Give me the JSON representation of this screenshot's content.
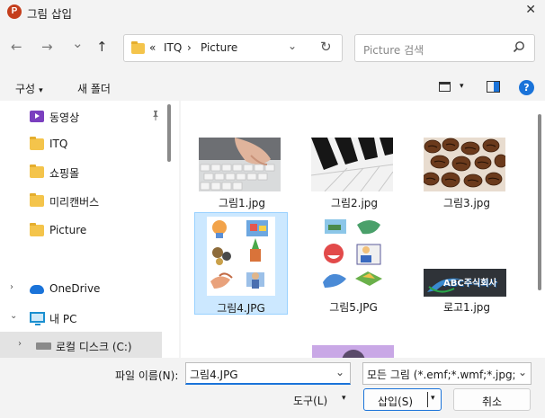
{
  "window": {
    "title": "그림 삽입",
    "app_icon": "P",
    "close": "✕"
  },
  "nav": {
    "back": "←",
    "forward": "→",
    "recent": "⌄",
    "up": "↑"
  },
  "address": {
    "prefix": "«",
    "segments": [
      "ITQ",
      "›",
      "Picture"
    ],
    "chevron": "⌄",
    "refresh": "↻"
  },
  "search": {
    "placeholder": "Picture 검색"
  },
  "toolbar": {
    "organize": "구성",
    "organize_caret": "▾",
    "new_folder": "새 폴더",
    "view_caret": "▾",
    "help": "?"
  },
  "sidebar": {
    "items": [
      {
        "label": "동영상",
        "icon": "video-icon",
        "pinned": true
      },
      {
        "label": "ITQ",
        "icon": "folder-icon"
      },
      {
        "label": "쇼핑몰",
        "icon": "folder-icon"
      },
      {
        "label": "미리캔버스",
        "icon": "folder-icon"
      },
      {
        "label": "Picture",
        "icon": "folder-icon"
      },
      {
        "label": "OneDrive",
        "icon": "cloud-icon",
        "expander": "›"
      },
      {
        "label": "내 PC",
        "icon": "pc-icon",
        "expander": "⌄"
      },
      {
        "label": "로컬 디스크 (C:)",
        "icon": "drive-icon",
        "expander": "›",
        "selected": true
      }
    ],
    "pin": "📌"
  },
  "files": [
    {
      "name": "그림1.jpg",
      "thumb": "keyboard"
    },
    {
      "name": "그림2.jpg",
      "thumb": "piano"
    },
    {
      "name": "그림3.jpg",
      "thumb": "coffee"
    },
    {
      "name": "그림4.JPG",
      "thumb": "clipart-a",
      "selected": true
    },
    {
      "name": "그림5.JPG",
      "thumb": "clipart-b"
    },
    {
      "name": "로고1.jpg",
      "thumb": "logo",
      "logo_text": "ABC주식회사"
    }
  ],
  "colors": {
    "accent": "#1a73d9",
    "selected_bg": "#cce8ff",
    "folder": "#f4c44b"
  },
  "bottom": {
    "filename_label": "파일 이름(N):",
    "filename_value": "그림4.JPG",
    "filetype_value": "모든 그림 (*.emf;*.wmf;*.jpg;*.jpeg;*",
    "tools": "도구(L)",
    "tools_caret": "▾",
    "insert": "삽입(S)",
    "insert_caret": "▾",
    "cancel": "취소"
  }
}
